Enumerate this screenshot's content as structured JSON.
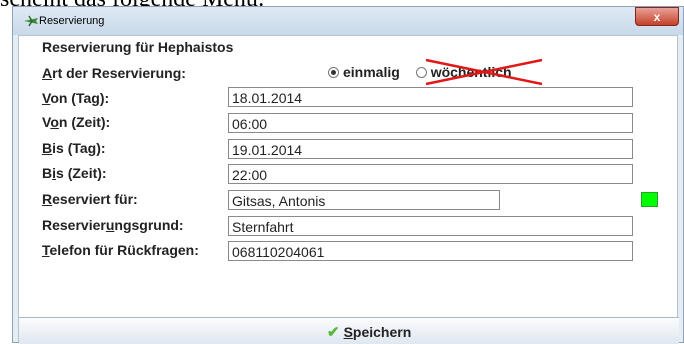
{
  "doc_fragment": "scheint das folgende Menü:",
  "window": {
    "title": "Reservierung",
    "close_glyph": "x"
  },
  "form": {
    "heading": "Reservierung für Hephaistos",
    "art": {
      "label": "Art der Reservierung:",
      "options": [
        {
          "label": "einmalig",
          "selected": true
        },
        {
          "label": "wöchentlich",
          "selected": false,
          "crossed_out": true
        }
      ]
    },
    "fields": [
      {
        "label": "Von (Tag):",
        "value": "18.01.2014"
      },
      {
        "label": "Von (Zeit):",
        "value": "06:00"
      },
      {
        "label": "Bis (Tag):",
        "value": "19.01.2014"
      },
      {
        "label": "Bis (Zeit):",
        "value": "22:00"
      },
      {
        "label": "Reserviert für:",
        "value": "Gitsas, Antonis"
      },
      {
        "label": "Reservierungsgrund:",
        "value": "Sternfahrt"
      },
      {
        "label": "Telefon für Rückfragen:",
        "value": "068110204061"
      }
    ],
    "status_color": "#00ff00"
  },
  "footer": {
    "save_label": "Speichern"
  },
  "colors": {
    "annotation_red": "#e01818",
    "status_green": "#00ff00"
  }
}
